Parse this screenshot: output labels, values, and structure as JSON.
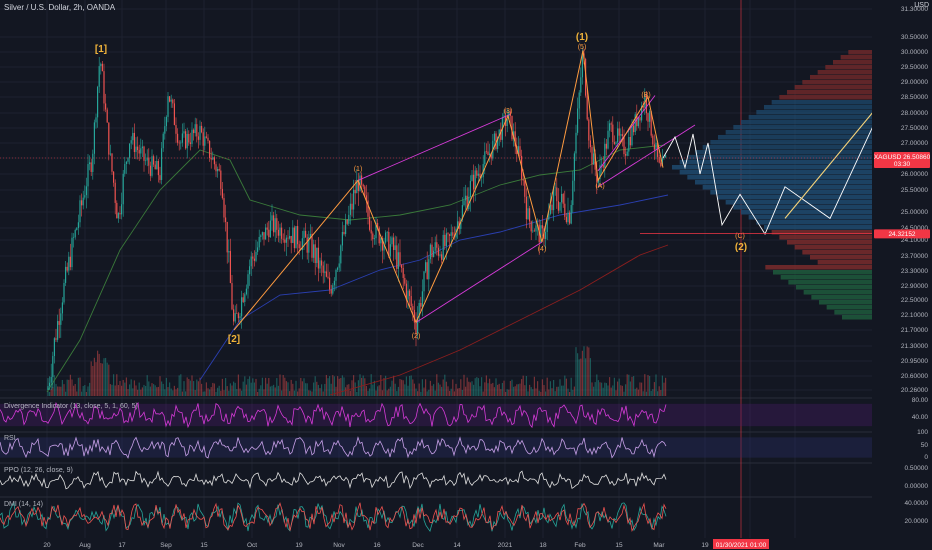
{
  "header": {
    "title": "Silver / U.S. Dollar, 2h, OANDA",
    "scale": "USD"
  },
  "chart_data": {
    "type": "candlestick",
    "symbol": "XAGUSD",
    "price_axis": {
      "ticks": [
        "31.30000",
        "30.50000",
        "30.00000",
        "29.50000",
        "29.00000",
        "28.50000",
        "28.00000",
        "27.50000",
        "27.00000",
        "26.50000",
        "26.00000",
        "25.50000",
        "25.00000",
        "24.50000",
        "24.10000",
        "23.70000",
        "23.30000",
        "22.90000",
        "22.50000",
        "22.10000",
        "21.70000",
        "21.30000",
        "20.95000",
        "20.60000",
        "20.26000"
      ],
      "range": [
        20.0,
        31.5
      ]
    },
    "last_price": {
      "symbol": "XAGUSD",
      "value": "26.50860",
      "countdown": "03:30",
      "color": "#f23645"
    },
    "target_line": {
      "value": "24.32152",
      "color": "#f23645"
    },
    "time_axis": {
      "labels": [
        "20",
        "Aug",
        "17",
        "Sep",
        "15",
        "Oct",
        "19",
        "Nov",
        "16",
        "Dec",
        "14",
        "2021",
        "18",
        "Feb",
        "15",
        "Mar",
        "19"
      ],
      "highlight_date": "01/30/2021",
      "highlight_time": "01:00"
    },
    "elliott_waves": {
      "primary": [
        {
          "label": "[1]",
          "date": "Aug",
          "price": 29.9,
          "color": "#f0b33a"
        },
        {
          "label": "[2]",
          "date": "Sep 20",
          "price": 21.7,
          "color": "#f0b33a"
        },
        {
          "label": "(1)",
          "date": "Feb 1",
          "price": 30.05,
          "color": "#f0b33a"
        },
        {
          "label": "(5)",
          "date": "Feb 1",
          "price": 30.05,
          "color": "#ff9b40"
        },
        {
          "label": "(2)",
          "date": "Mar",
          "price": 24.2,
          "color": "#f0b33a"
        }
      ],
      "intermediate": [
        {
          "label": "(1)",
          "date": "Nov 6",
          "price": 25.8
        },
        {
          "label": "(2)",
          "date": "Nov 30",
          "price": 21.9
        },
        {
          "label": "(3)",
          "date": "Jan 6",
          "price": 27.9
        },
        {
          "label": "(4)",
          "date": "Jan 18",
          "price": 24.05
        },
        {
          "label": "(A)",
          "date": "Feb 5",
          "price": 25.8
        },
        {
          "label": "(B)",
          "date": "Feb 22",
          "price": 28.5
        },
        {
          "label": "(C)",
          "date": "Mar 23",
          "price": 24.3
        }
      ],
      "projection": [
        26.5,
        27.2,
        26.2,
        27.3,
        26.0,
        27.0,
        24.6,
        25.4,
        24.3,
        25.6,
        24.8,
        28.6
      ]
    },
    "series": [
      {
        "name": "",
        "color": "#26a69a",
        "values": []
      }
    ],
    "indicators": [
      {
        "name": "Divergence Indicator (13, close, 5, 1, 60, 5)",
        "ticks": [
          "80.00",
          "40.00"
        ],
        "color": "#d63bd8"
      },
      {
        "name": "RSI",
        "ticks": [
          "100",
          "50",
          "0"
        ],
        "color": "#7e57c2"
      },
      {
        "name": "PPO (12, 26, close, 9)",
        "ticks": [
          "0.50000",
          "0.00000"
        ],
        "color": "#ff5252"
      },
      {
        "name": "DMI (14, 14)",
        "ticks": [
          "40.0000",
          "20.0000"
        ],
        "color": "#26a69a"
      }
    ],
    "grid": true
  }
}
